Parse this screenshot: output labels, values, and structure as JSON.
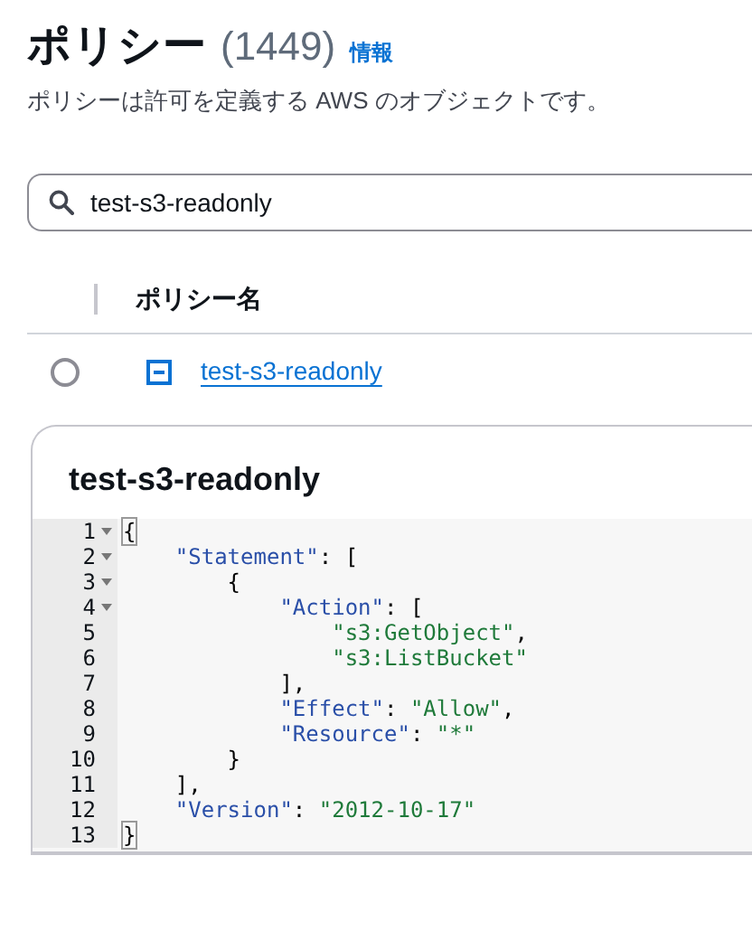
{
  "header": {
    "title": "ポリシー",
    "count": "(1449)",
    "info_link": "情報",
    "description": "ポリシーは許可を定義する AWS のオブジェクトです。"
  },
  "search": {
    "value": "test-s3-readonly"
  },
  "table": {
    "columns": [
      "ポリシー名"
    ],
    "rows": [
      {
        "selected": false,
        "expanded": true,
        "name": "test-s3-readonly"
      }
    ]
  },
  "detail": {
    "title": "test-s3-readonly",
    "code_lines": [
      {
        "number": "1",
        "foldable": true,
        "tokens": [
          {
            "kind": "punct",
            "text": "{",
            "matched": true
          }
        ]
      },
      {
        "number": "2",
        "foldable": true,
        "tokens": [
          {
            "kind": "key",
            "text": "    \"Statement\""
          },
          {
            "kind": "punct",
            "text": ": ["
          }
        ]
      },
      {
        "number": "3",
        "foldable": true,
        "tokens": [
          {
            "kind": "punct",
            "text": "        {"
          }
        ]
      },
      {
        "number": "4",
        "foldable": true,
        "tokens": [
          {
            "kind": "key",
            "text": "            \"Action\""
          },
          {
            "kind": "punct",
            "text": ": ["
          }
        ]
      },
      {
        "number": "5",
        "foldable": false,
        "tokens": [
          {
            "kind": "string",
            "text": "                \"s3:GetObject\""
          },
          {
            "kind": "punct",
            "text": ","
          }
        ]
      },
      {
        "number": "6",
        "foldable": false,
        "tokens": [
          {
            "kind": "string",
            "text": "                \"s3:ListBucket\""
          }
        ]
      },
      {
        "number": "7",
        "foldable": false,
        "tokens": [
          {
            "kind": "punct",
            "text": "            ],"
          }
        ]
      },
      {
        "number": "8",
        "foldable": false,
        "tokens": [
          {
            "kind": "key",
            "text": "            \"Effect\""
          },
          {
            "kind": "punct",
            "text": ": "
          },
          {
            "kind": "string",
            "text": "\"Allow\""
          },
          {
            "kind": "punct",
            "text": ","
          }
        ]
      },
      {
        "number": "9",
        "foldable": false,
        "tokens": [
          {
            "kind": "key",
            "text": "            \"Resource\""
          },
          {
            "kind": "punct",
            "text": ": "
          },
          {
            "kind": "string",
            "text": "\"*\""
          }
        ]
      },
      {
        "number": "10",
        "foldable": false,
        "tokens": [
          {
            "kind": "punct",
            "text": "        }"
          }
        ]
      },
      {
        "number": "11",
        "foldable": false,
        "tokens": [
          {
            "kind": "punct",
            "text": "    ],"
          }
        ]
      },
      {
        "number": "12",
        "foldable": false,
        "tokens": [
          {
            "kind": "key",
            "text": "    \"Version\""
          },
          {
            "kind": "punct",
            "text": ": "
          },
          {
            "kind": "string",
            "text": "\"2012-10-17\""
          }
        ]
      },
      {
        "number": "13",
        "foldable": false,
        "tokens": [
          {
            "kind": "punct",
            "text": "}",
            "matched": true
          }
        ]
      }
    ]
  }
}
